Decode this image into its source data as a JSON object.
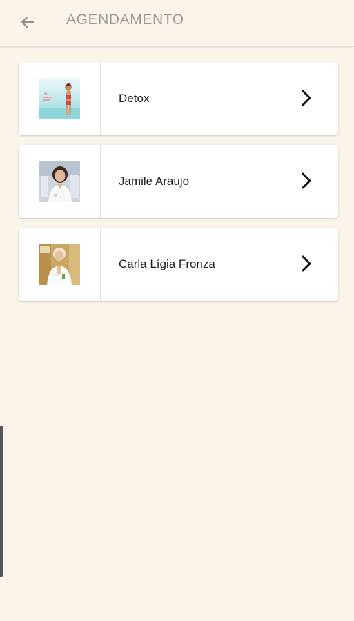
{
  "header": {
    "title": "AGENDAMENTO",
    "back_icon": "arrow-left-icon"
  },
  "items": [
    {
      "label": "Detox",
      "thumbnail": "detox-thumbnail",
      "chevron_icon": "chevron-right-icon"
    },
    {
      "label": "Jamile Araujo",
      "thumbnail": "jamile-araujo-photo",
      "chevron_icon": "chevron-right-icon"
    },
    {
      "label": "Carla Lígia Fronza",
      "thumbnail": "carla-ligia-fronza-photo",
      "chevron_icon": "chevron-right-icon"
    }
  ],
  "colors": {
    "background": "#fbf4ea",
    "card": "#ffffff",
    "title": "#9a9a9a",
    "text": "#1f1f1f"
  }
}
